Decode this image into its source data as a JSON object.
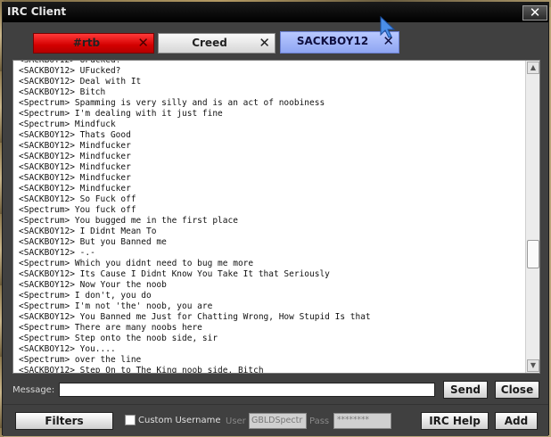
{
  "window": {
    "title": "IRC Client",
    "close_glyph": "✕"
  },
  "tabs": [
    {
      "label": "#rtb",
      "close": "✕",
      "color": "#e00000"
    },
    {
      "label": "Creed",
      "close": "✕",
      "color": "#e6e6e6"
    },
    {
      "label": "SACKBOY12",
      "close": "✕",
      "color": "#9fb3f5",
      "active": true
    }
  ],
  "chat": {
    "lines": [
      "<SACKBOY12> UFucked!",
      "<SACKBOY12> UFucked?",
      "<SACKBOY12> Deal with It",
      "<SACKBOY12> Bitch",
      "<Spectrum> Spamming is very silly and is an act of noobiness",
      "<Spectrum> I'm dealing with it just fine",
      "<Spectrum> Mindfuck",
      "<SACKBOY12> Thats Good",
      "<SACKBOY12> Mindfucker",
      "<SACKBOY12> Mindfucker",
      "<SACKBOY12> Mindfucker",
      "<SACKBOY12> Mindfucker",
      "<SACKBOY12> Mindfucker",
      "<SACKBOY12> So Fuck off",
      "<Spectrum> You fuck off",
      "<Spectrum> You bugged me in the first place",
      "<SACKBOY12> I Didnt Mean To",
      "<SACKBOY12> But you Banned me",
      "<SACKBOY12> -.-",
      "<Spectrum> Which you didnt need to bug me more",
      "<SACKBOY12> Its Cause I Didnt Know You Take It that Seriously",
      "<SACKBOY12> Now Your the noob",
      "<Spectrum> I don't, you do",
      "<Spectrum> I'm not 'the' noob, you are",
      "<SACKBOY12> You Banned me Just for Chatting Wrong, How Stupid Is that",
      "<Spectrum> There are many noobs here",
      "<Spectrum> Step onto the noob side, sir",
      "<SACKBOY12> You....",
      "<Spectrum> over the line",
      "<SACKBOY12> Step On to The King noob side, Bitch"
    ],
    "scroll_up": "▲",
    "scroll_down": "▼"
  },
  "message": {
    "label": "Message:",
    "value": "",
    "send": "Send",
    "close": "Close"
  },
  "footer": {
    "filters": "Filters",
    "custom_username": "Custom Username",
    "user_label": "User",
    "user_value": "GBLDSpectr",
    "pass_label": "Pass",
    "pass_value": "********",
    "help": "IRC Help",
    "add": "Add"
  }
}
